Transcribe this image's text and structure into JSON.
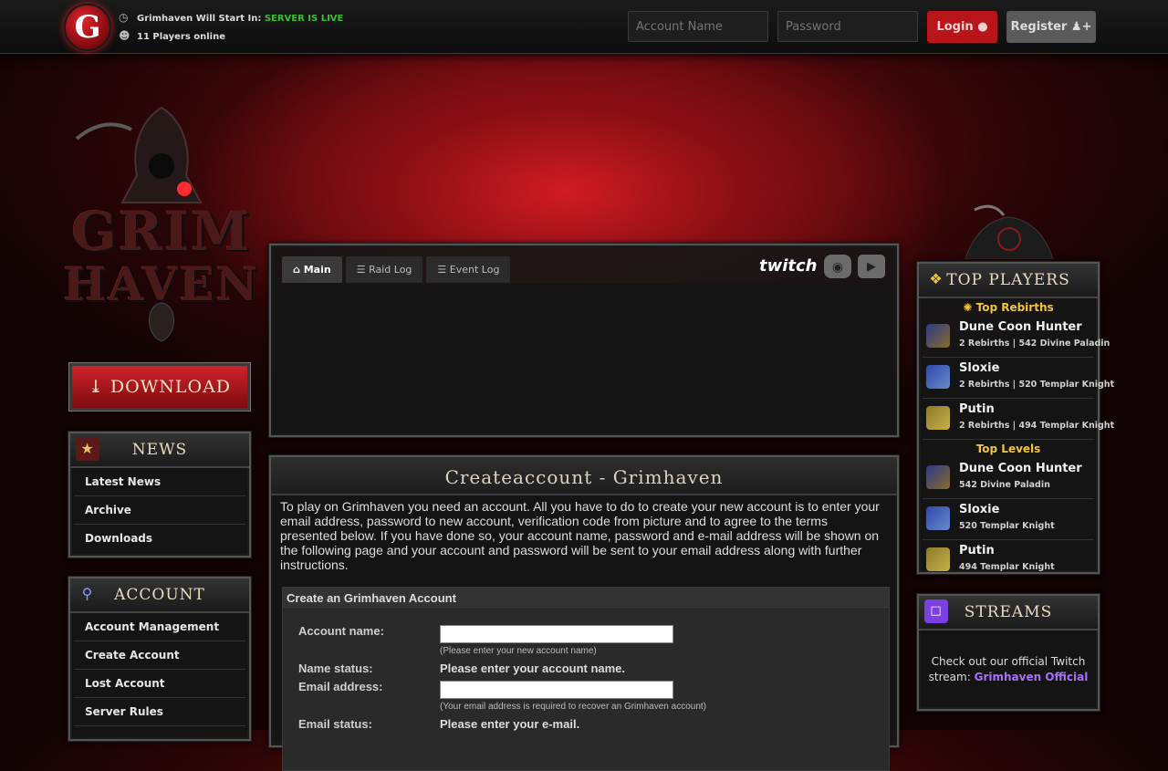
{
  "topbar": {
    "logo_letter": "G",
    "countdown_label": "Grimhaven Will Start In:",
    "server_status": "SERVER IS LIVE",
    "players_online": "11 Players online",
    "account_placeholder": "Account Name",
    "password_placeholder": "Password",
    "login_label": "Login",
    "register_label": "Register"
  },
  "logo": {
    "line1": "GRIM",
    "line2": "HAVEN"
  },
  "download_label": "DOWNLOAD",
  "news": {
    "title": "NEWS",
    "items": [
      "Latest News",
      "Archive",
      "Downloads"
    ]
  },
  "account": {
    "title": "ACCOUNT",
    "items": [
      "Account Management",
      "Create Account",
      "Lost Account",
      "Server Rules"
    ]
  },
  "tabs": [
    "Main",
    "Raid Log",
    "Event Log"
  ],
  "social": {
    "twitch": "twitch"
  },
  "main": {
    "title": "Createaccount - Grimhaven",
    "intro": "To play on Grimhaven you need an account. All you have to do to create your new account is to enter your email address, password to new account, verification code from picture and to agree to the terms presented below. If you have done so, your account name, password and e-mail address will be shown on the following page and your account and password will be sent to your email address along with further instructions.",
    "form_title": "Create an Grimhaven Account",
    "account_name_label": "Account name:",
    "account_name_hint": "(Please enter your new account name)",
    "name_status_label": "Name status:",
    "name_status_value": "Please enter your account name.",
    "email_label": "Email address:",
    "email_hint": "(Your email address is required to recover an Grimhaven account)",
    "email_status_label": "Email status:",
    "email_status_value": "Please enter your e-mail."
  },
  "top_players": {
    "title": "TOP PLAYERS",
    "rebirths_title": "Top Rebirths",
    "rebirths": [
      {
        "name": "Dune Coon Hunter",
        "info": "2 Rebirths | 542 Divine Paladin"
      },
      {
        "name": "Sloxie",
        "info": "2 Rebirths | 520 Templar Knight"
      },
      {
        "name": "Putin",
        "info": "2 Rebirths | 494 Templar Knight"
      }
    ],
    "levels_title": "Top Levels",
    "levels": [
      {
        "name": "Dune Coon Hunter",
        "info": "542 Divine Paladin"
      },
      {
        "name": "Sloxie",
        "info": "520 Templar Knight"
      },
      {
        "name": "Putin",
        "info": "494 Templar Knight"
      }
    ]
  },
  "streams": {
    "title": "STREAMS",
    "text": "Check out our official Twitch stream:",
    "link": "Grimhaven Official"
  },
  "colors": {
    "accent_red": "#b8151a",
    "live_green": "#37c12f",
    "gold": "#f2c43a",
    "twitch_purple": "#a970ff"
  }
}
